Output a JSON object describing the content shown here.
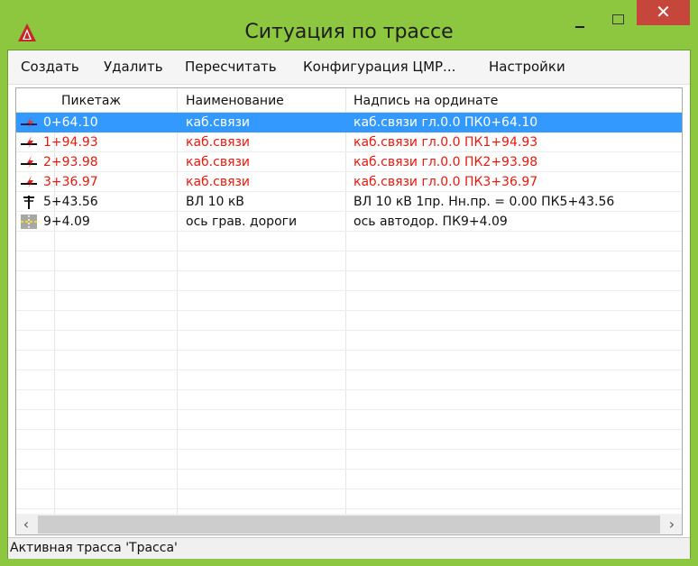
{
  "window": {
    "title": "Ситуация по трассе",
    "close_glyph": "✕"
  },
  "menu": {
    "items": [
      "Создать",
      "Удалить",
      "Пересчитать",
      "Конфигурация ЦМР...",
      "Настройки"
    ]
  },
  "table": {
    "columns": [
      "Пикетаж",
      "Наименование",
      "Надпись на ординате"
    ],
    "rows": [
      {
        "icon": "cable-crossing-icon",
        "picket": "0+64.10",
        "name": "каб.связи",
        "label": "каб.связи гл.0.0 ПК0+64.10",
        "color": "#ffffff",
        "selected": true
      },
      {
        "icon": "cable-crossing-icon",
        "picket": "1+94.93",
        "name": "каб.связи",
        "label": "каб.связи гл.0.0 ПК1+94.93",
        "color": "#e8190f",
        "selected": false
      },
      {
        "icon": "cable-crossing-icon",
        "picket": "2+93.98",
        "name": "каб.связи",
        "label": "каб.связи гл.0.0 ПК2+93.98",
        "color": "#e8190f",
        "selected": false
      },
      {
        "icon": "cable-crossing-icon",
        "picket": "3+36.97",
        "name": "каб.связи",
        "label": "каб.связи гл.0.0 ПК3+36.97",
        "color": "#e8190f",
        "selected": false
      },
      {
        "icon": "power-line-pole-icon",
        "picket": "5+43.56",
        "name": "ВЛ 10 кВ",
        "label": "ВЛ 10 кВ 1пр. Нн.пр. = 0.00 ПК5+43.56",
        "color": "#111111",
        "selected": false
      },
      {
        "icon": "road-axis-icon",
        "picket": "9+4.09",
        "name": "ось грав. дороги",
        "label": "ось  автодор. ПК9+4.09",
        "color": "#111111",
        "selected": false
      }
    ]
  },
  "scrollbar": {
    "left_glyph": "‹",
    "right_glyph": "›"
  },
  "status": {
    "text": "Активная трасса 'Трасса'"
  },
  "colors": {
    "titlebar": "#8dc63f",
    "selection": "#3399ff",
    "close_button": "#c7463b",
    "error_text": "#e8190f"
  }
}
